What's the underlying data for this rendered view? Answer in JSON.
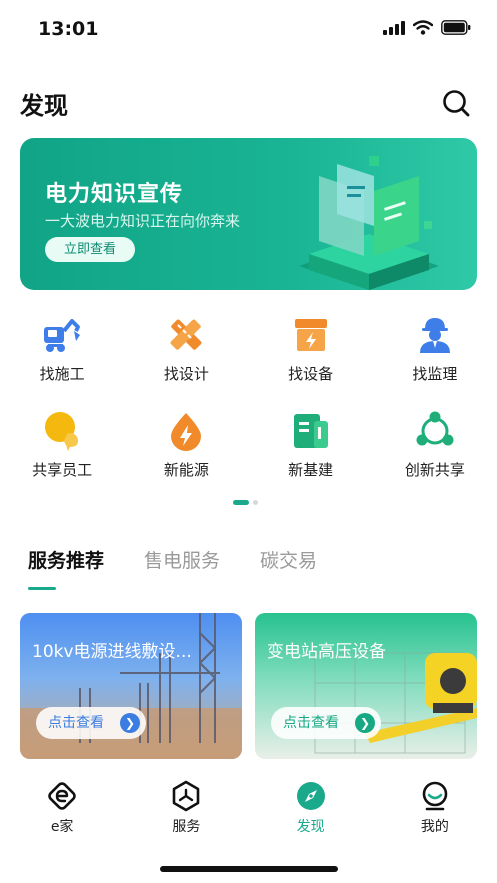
{
  "status_bar": {
    "time": "13:01"
  },
  "header": {
    "title": "发现"
  },
  "banner": {
    "title": "电力知识宣传",
    "subtitle": "一大波电力知识正在向你奔来",
    "button_label": "立即查看"
  },
  "grid": {
    "items": [
      {
        "label": "找施工",
        "icon": "excavator-icon",
        "color": "#3f7ee8"
      },
      {
        "label": "找设计",
        "icon": "ruler-pencil-icon",
        "color": "#f08a2a"
      },
      {
        "label": "找设备",
        "icon": "equipment-box-icon",
        "color": "#f08a2a"
      },
      {
        "label": "找监理",
        "icon": "supervisor-helmet-icon",
        "color": "#3f7ee8"
      },
      {
        "label": "共享员工",
        "icon": "shared-staff-icon",
        "color": "#f5b80f"
      },
      {
        "label": "新能源",
        "icon": "energy-drop-icon",
        "color": "#f08a2a"
      },
      {
        "label": "新基建",
        "icon": "infrastructure-icon",
        "color": "#1fae7a"
      },
      {
        "label": "创新共享",
        "icon": "share-cycle-icon",
        "color": "#1fae7a"
      }
    ]
  },
  "tabs": [
    {
      "label": "服务推荐",
      "active": true
    },
    {
      "label": "售电服务",
      "active": false
    },
    {
      "label": "碳交易",
      "active": false
    }
  ],
  "cards": [
    {
      "title": "10kv电源进线敷设...",
      "button_label": "点击查看"
    },
    {
      "title": "变电站高压设备",
      "button_label": "点击查看"
    }
  ],
  "tabbar": [
    {
      "label": "e家",
      "icon": "e-home-icon",
      "active": false
    },
    {
      "label": "服务",
      "icon": "service-hexagon-icon",
      "active": false
    },
    {
      "label": "发现",
      "icon": "compass-icon",
      "active": true
    },
    {
      "label": "我的",
      "icon": "profile-icon",
      "active": false
    }
  ],
  "colors": {
    "accent": "#1aa98a",
    "banner": "#14a98a"
  }
}
